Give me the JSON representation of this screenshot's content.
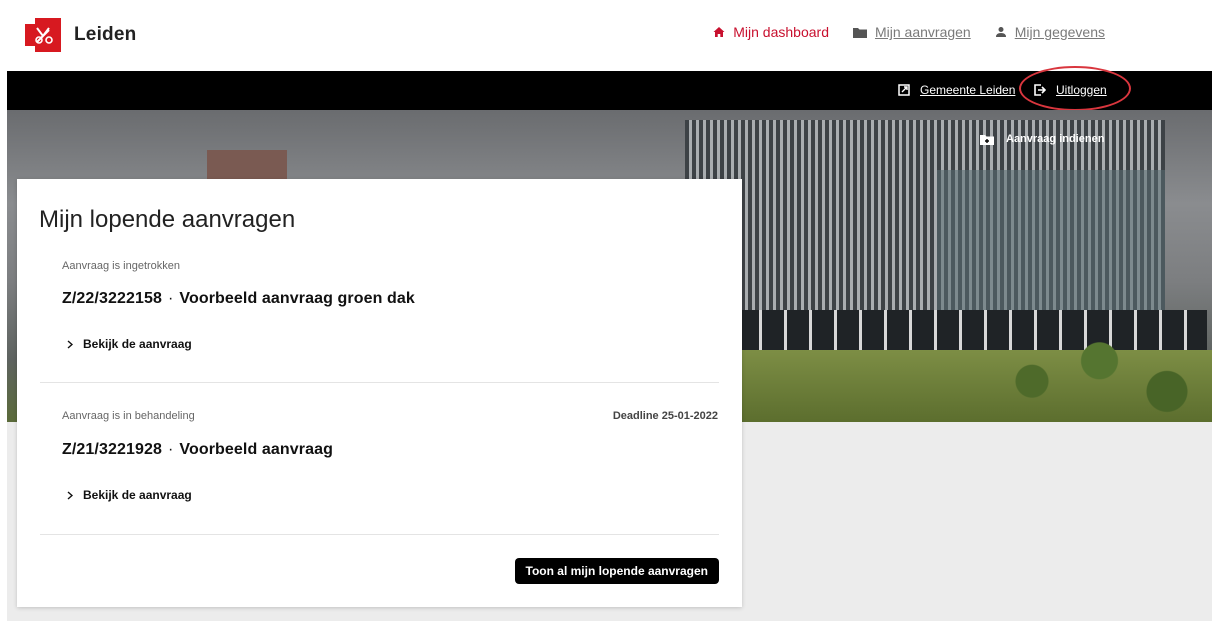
{
  "header": {
    "logo_text": "Leiden",
    "brand_color": "#c8102e",
    "nav": [
      {
        "label": "Mijn dashboard",
        "icon": "home-icon",
        "active": true
      },
      {
        "label": "Mijn aanvragen",
        "icon": "folder-icon",
        "active": false
      },
      {
        "label": "Mijn gegevens",
        "icon": "user-icon",
        "active": false
      }
    ]
  },
  "topbar": {
    "external_link": "Gemeente Leiden",
    "logout": "Uitloggen"
  },
  "hero": {
    "apply_link": "Aanvraag indienen"
  },
  "card": {
    "title": "Mijn lopende aanvragen",
    "requests": [
      {
        "status": "Aanvraag is ingetrokken",
        "deadline": "",
        "number": "Z/22/3222158",
        "name": "Voorbeeld aanvraag groen dak",
        "link": "Bekijk de aanvraag"
      },
      {
        "status": "Aanvraag is in behandeling",
        "deadline": "Deadline 25-01-2022",
        "number": "Z/21/3221928",
        "name": "Voorbeeld aanvraag",
        "link": "Bekijk de aanvraag"
      }
    ],
    "separator": "·",
    "show_all_button": "Toon al mijn lopende aanvragen"
  }
}
